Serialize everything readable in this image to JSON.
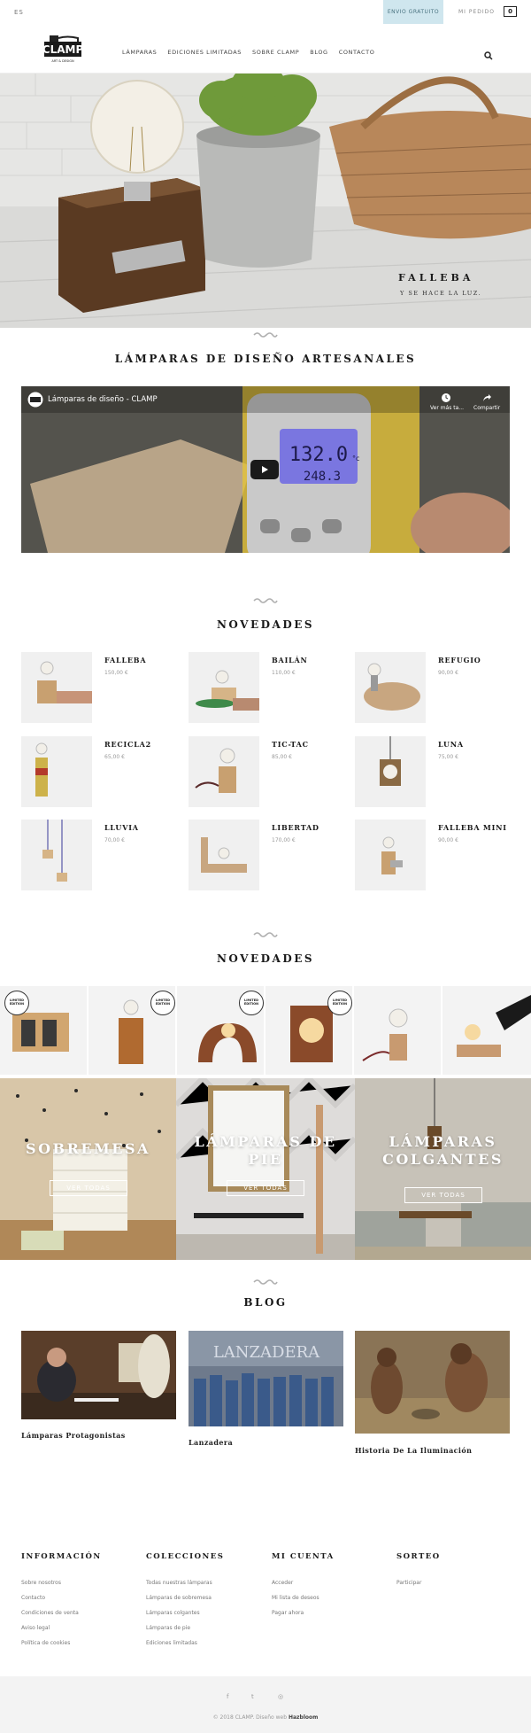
{
  "topbar": {
    "language": "ES",
    "shipping": "ENVIO GRATUITO",
    "my_order": "MI PEDIDO",
    "cart_count": "0"
  },
  "header": {
    "logo_text": "CLAMP",
    "logo_sub": "ART & DESIGN",
    "nav": [
      "LÁMPARAS",
      "EDICIONES LIMITADAS",
      "SOBRE CLAMP",
      "BLOG",
      "CONTACTO"
    ]
  },
  "hero": {
    "title": "FALLEBA",
    "subtitle": "Y SE HACE LA LUZ."
  },
  "section1": {
    "title": "LÁMPARAS DE DISEÑO ARTESANALES"
  },
  "video": {
    "title": "Lámparas de diseño - CLAMP",
    "watch_later": "Ver más ta...",
    "share": "Compartir",
    "display_temp": "132.0",
    "display_unit": "°c",
    "display_sub": "248.3"
  },
  "novedades1": {
    "title": "NOVEDADES",
    "products": [
      {
        "name": "FALLEBA",
        "price": "150,00 €"
      },
      {
        "name": "BAILÁN",
        "price": "110,00 €"
      },
      {
        "name": "REFUGIO",
        "price": "90,00 €"
      },
      {
        "name": "RECICLA2",
        "price": "65,00 €"
      },
      {
        "name": "TIC-TAC",
        "price": "85,00 €"
      },
      {
        "name": "LUNA",
        "price": "75,00 €"
      },
      {
        "name": "LLUVIA",
        "price": "70,00 €"
      },
      {
        "name": "LIBERTAD",
        "price": "170,00 €"
      },
      {
        "name": "FALLEBA MINI",
        "price": "90,00 €"
      }
    ]
  },
  "novedades2": {
    "title": "NOVEDADES",
    "badge": "LIMITED EDITION"
  },
  "categories": [
    {
      "line1": "SOBREMESA",
      "line2": "",
      "button": "VER TODAS"
    },
    {
      "line1": "LÁMPARAS DE",
      "line2": "PIE",
      "button": "VER TODAS"
    },
    {
      "line1": "LÁMPARAS",
      "line2": "COLGANTES",
      "button": "VER TODAS"
    }
  ],
  "blog": {
    "title": "BLOG",
    "posts": [
      {
        "title": "Lámparas Protagonistas"
      },
      {
        "title": "Lanzadera"
      },
      {
        "title": "Historia De La Iluminación"
      }
    ],
    "lanzadera_sign": "LANZADERA"
  },
  "footer": {
    "columns": [
      {
        "title": "INFORMACIÓN",
        "links": [
          "Sobre nosotros",
          "Contacto",
          "Condiciones de venta",
          "Aviso legal",
          "Política de cookies"
        ]
      },
      {
        "title": "COLECCIONES",
        "links": [
          "Todas nuestras lámparas",
          "Lámparas de sobremesa",
          "Lámparas colgantes",
          "Lámparas de pie",
          "Ediciones limitadas"
        ]
      },
      {
        "title": "MI CUENTA",
        "links": [
          "Acceder",
          "Mi lista de deseos",
          "Pagar ahora"
        ]
      },
      {
        "title": "SORTEO",
        "links": [
          "Participar"
        ]
      }
    ],
    "social": [
      "f",
      "t",
      "◎"
    ],
    "copyright": "© 2018 CLAMP. Diseño web",
    "credit": "Hazbloom"
  },
  "colors": {
    "shipping_bg": "#cfe6ee",
    "accent_wave": "#b0b0b0"
  }
}
